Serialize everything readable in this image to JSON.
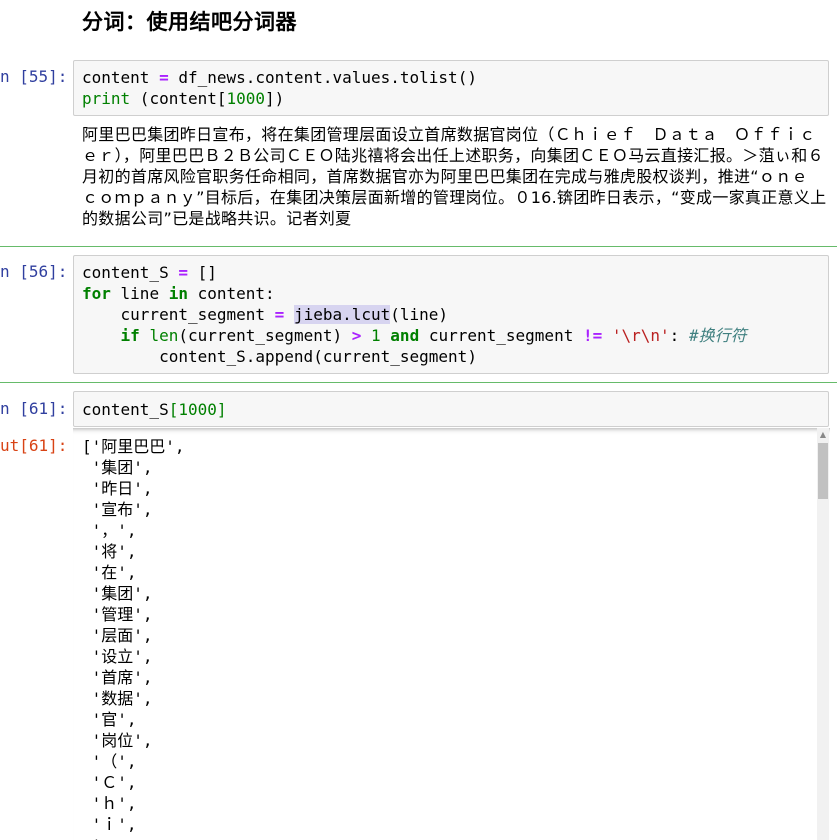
{
  "heading": "分词：使用结吧分词器",
  "cells": {
    "c55": {
      "prompt": "n [55]:",
      "line1": {
        "a": "content ",
        "b": "=",
        "c": " df_news.content.values.tolist()"
      },
      "line2": {
        "a": "print",
        "b": " (content[",
        "c": "1000",
        "d": "])"
      },
      "output": "阿里巴巴集团昨日宣布，将在集团管理层面设立首席数据官岗位（Ｃｈｉｅｆ　Ｄａｔａ　Ｏｆｆｉｃｅｒ），阿里巴巴Ｂ２Ｂ公司ＣＥＯ陆兆禧将会出任上述职务，向集团ＣＥＯ马云直接汇报。＞菹ぃ和６月初的首席风险官职务任命相同，首席数据官亦为阿里巴巴集团在完成与雅虎股权谈判，推进“ｏｎｅ　ｃｏｍｐａｎｙ”目标后，在集团决策层面新增的管理岗位。０16.锛团昨日表示，“变成一家真正意义上的数据公司”已是战略共识。记者刘夏"
    },
    "c56": {
      "prompt": "n [56]:",
      "l1": {
        "a": "content_S ",
        "b": "=",
        "c": " []"
      },
      "l2": {
        "a": "for",
        "b": " line ",
        "c": "in",
        "d": " content:"
      },
      "l3": {
        "a": "    current_segment ",
        "b": "=",
        "c": " ",
        "d": "jieba.lcut",
        "e": "(line)"
      },
      "l4": {
        "a": "    ",
        "b": "if",
        "c": " ",
        "d": "len",
        "e": "(current_segment) ",
        "f": ">",
        "g": " ",
        "h": "1",
        "i": " ",
        "j": "and",
        "k": " current_segment ",
        "l": "!=",
        "m": " ",
        "n": "'\\r\\n'",
        "o": ": ",
        "p": "#换行符"
      },
      "l5": {
        "a": "        content_S.append(current_segment)"
      }
    },
    "c61": {
      "prompt": "n [61]:",
      "code": {
        "a": "content_S",
        "b": "[",
        "c": "1000",
        "d": "]"
      },
      "out_prompt": "ut[61]:",
      "output_lines": [
        "['阿里巴巴',",
        " '集团',",
        " '昨日',",
        " '宣布',",
        " '，',",
        " '将',",
        " '在',",
        " '集团',",
        " '管理',",
        " '层面',",
        " '设立',",
        " '首席',",
        " '数据',",
        " '官',",
        " '岗位',",
        " '（',",
        " 'Ｃ',",
        " 'ｈ',",
        " 'ｉ',",
        " '"
      ]
    }
  },
  "icons": {
    "scroll_up": "scroll-up-arrow-icon"
  },
  "colors": {
    "prompt_in": "#303f9f",
    "prompt_out": "#d84315",
    "separator": "#66bb6a"
  }
}
